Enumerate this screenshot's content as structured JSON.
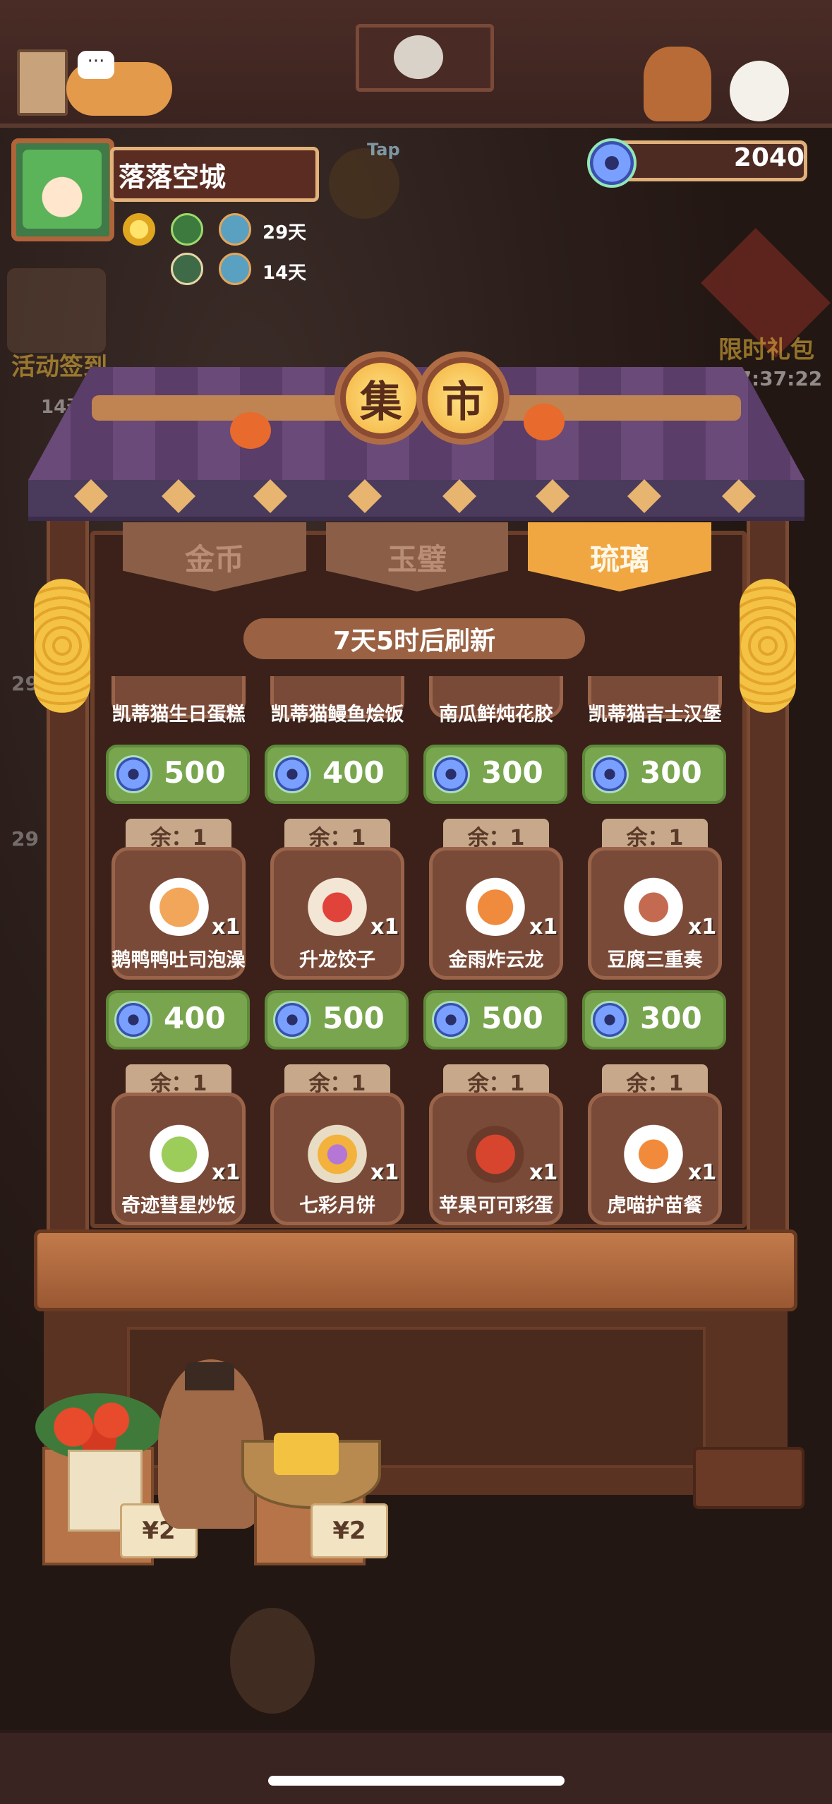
{
  "player": {
    "name": "落落空城"
  },
  "buffs": [
    {
      "days": "29天"
    },
    {
      "days": "14天"
    }
  ],
  "currency": {
    "amount": "2040",
    "icon": "jade-disc-icon"
  },
  "side_left": {
    "signin": "活动签到",
    "signin_days": "14天",
    "partial_1": "29",
    "partial_2": "29"
  },
  "side_right": {
    "gift": "限时礼包",
    "gift_timer": "17:37:22"
  },
  "market": {
    "sign_chars": [
      "集",
      "市"
    ],
    "tab_hint": "Tap"
  },
  "tabs": [
    {
      "label": "金币",
      "active": false
    },
    {
      "label": "玉璧",
      "active": false
    },
    {
      "label": "琉璃",
      "active": true
    }
  ],
  "refresh_text": "7天5时后刷新",
  "row0": {
    "items": [
      {
        "name": "凯蒂猫生日蛋糕",
        "price": "500"
      },
      {
        "name": "凯蒂猫鳗鱼烩饭",
        "price": "400"
      },
      {
        "name": "南瓜鲜炖花胶",
        "price": "300"
      },
      {
        "name": "凯蒂猫吉士汉堡",
        "price": "300"
      }
    ]
  },
  "row1": {
    "items": [
      {
        "stock": "余：1",
        "name": "鹅鸭鸭吐司泡澡",
        "qty": "x1",
        "price": "400"
      },
      {
        "stock": "余：1",
        "name": "升龙饺子",
        "qty": "x1",
        "price": "500"
      },
      {
        "stock": "余：1",
        "name": "金雨炸云龙",
        "qty": "x1",
        "price": "500"
      },
      {
        "stock": "余：1",
        "name": "豆腐三重奏",
        "qty": "x1",
        "price": "300"
      }
    ]
  },
  "row2": {
    "items": [
      {
        "stock": "余：1",
        "name": "奇迹彗星炒饭",
        "qty": "x1"
      },
      {
        "stock": "余：1",
        "name": "七彩月饼",
        "qty": "x1"
      },
      {
        "stock": "余：1",
        "name": "苹果可可彩蛋",
        "qty": "x1"
      },
      {
        "stock": "余：1",
        "name": "虎喵护苗餐",
        "qty": "x1"
      }
    ]
  },
  "counter": {
    "left_price": "¥2",
    "right_price": "¥2"
  },
  "colors": {
    "accent": "#f0a742",
    "buy_button": "#78a54d",
    "board": "#3b2119"
  }
}
